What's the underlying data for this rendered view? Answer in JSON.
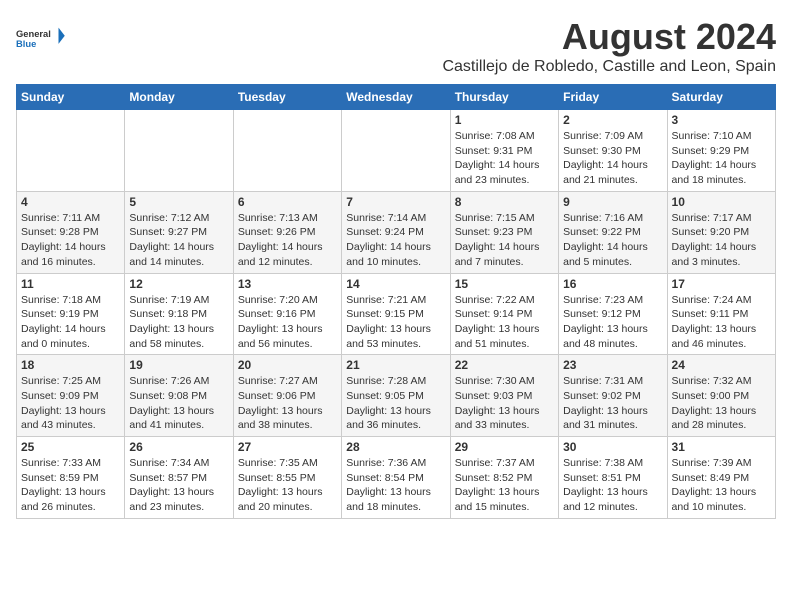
{
  "header": {
    "logo_general": "General",
    "logo_blue": "Blue",
    "month_year": "August 2024",
    "location": "Castillejo de Robledo, Castille and Leon, Spain"
  },
  "weekdays": [
    "Sunday",
    "Monday",
    "Tuesday",
    "Wednesday",
    "Thursday",
    "Friday",
    "Saturday"
  ],
  "weeks": [
    [
      {
        "day": "",
        "sunrise": "",
        "sunset": "",
        "daylight": ""
      },
      {
        "day": "",
        "sunrise": "",
        "sunset": "",
        "daylight": ""
      },
      {
        "day": "",
        "sunrise": "",
        "sunset": "",
        "daylight": ""
      },
      {
        "day": "",
        "sunrise": "",
        "sunset": "",
        "daylight": ""
      },
      {
        "day": "1",
        "sunrise": "Sunrise: 7:08 AM",
        "sunset": "Sunset: 9:31 PM",
        "daylight": "Daylight: 14 hours and 23 minutes."
      },
      {
        "day": "2",
        "sunrise": "Sunrise: 7:09 AM",
        "sunset": "Sunset: 9:30 PM",
        "daylight": "Daylight: 14 hours and 21 minutes."
      },
      {
        "day": "3",
        "sunrise": "Sunrise: 7:10 AM",
        "sunset": "Sunset: 9:29 PM",
        "daylight": "Daylight: 14 hours and 18 minutes."
      }
    ],
    [
      {
        "day": "4",
        "sunrise": "Sunrise: 7:11 AM",
        "sunset": "Sunset: 9:28 PM",
        "daylight": "Daylight: 14 hours and 16 minutes."
      },
      {
        "day": "5",
        "sunrise": "Sunrise: 7:12 AM",
        "sunset": "Sunset: 9:27 PM",
        "daylight": "Daylight: 14 hours and 14 minutes."
      },
      {
        "day": "6",
        "sunrise": "Sunrise: 7:13 AM",
        "sunset": "Sunset: 9:26 PM",
        "daylight": "Daylight: 14 hours and 12 minutes."
      },
      {
        "day": "7",
        "sunrise": "Sunrise: 7:14 AM",
        "sunset": "Sunset: 9:24 PM",
        "daylight": "Daylight: 14 hours and 10 minutes."
      },
      {
        "day": "8",
        "sunrise": "Sunrise: 7:15 AM",
        "sunset": "Sunset: 9:23 PM",
        "daylight": "Daylight: 14 hours and 7 minutes."
      },
      {
        "day": "9",
        "sunrise": "Sunrise: 7:16 AM",
        "sunset": "Sunset: 9:22 PM",
        "daylight": "Daylight: 14 hours and 5 minutes."
      },
      {
        "day": "10",
        "sunrise": "Sunrise: 7:17 AM",
        "sunset": "Sunset: 9:20 PM",
        "daylight": "Daylight: 14 hours and 3 minutes."
      }
    ],
    [
      {
        "day": "11",
        "sunrise": "Sunrise: 7:18 AM",
        "sunset": "Sunset: 9:19 PM",
        "daylight": "Daylight: 14 hours and 0 minutes."
      },
      {
        "day": "12",
        "sunrise": "Sunrise: 7:19 AM",
        "sunset": "Sunset: 9:18 PM",
        "daylight": "Daylight: 13 hours and 58 minutes."
      },
      {
        "day": "13",
        "sunrise": "Sunrise: 7:20 AM",
        "sunset": "Sunset: 9:16 PM",
        "daylight": "Daylight: 13 hours and 56 minutes."
      },
      {
        "day": "14",
        "sunrise": "Sunrise: 7:21 AM",
        "sunset": "Sunset: 9:15 PM",
        "daylight": "Daylight: 13 hours and 53 minutes."
      },
      {
        "day": "15",
        "sunrise": "Sunrise: 7:22 AM",
        "sunset": "Sunset: 9:14 PM",
        "daylight": "Daylight: 13 hours and 51 minutes."
      },
      {
        "day": "16",
        "sunrise": "Sunrise: 7:23 AM",
        "sunset": "Sunset: 9:12 PM",
        "daylight": "Daylight: 13 hours and 48 minutes."
      },
      {
        "day": "17",
        "sunrise": "Sunrise: 7:24 AM",
        "sunset": "Sunset: 9:11 PM",
        "daylight": "Daylight: 13 hours and 46 minutes."
      }
    ],
    [
      {
        "day": "18",
        "sunrise": "Sunrise: 7:25 AM",
        "sunset": "Sunset: 9:09 PM",
        "daylight": "Daylight: 13 hours and 43 minutes."
      },
      {
        "day": "19",
        "sunrise": "Sunrise: 7:26 AM",
        "sunset": "Sunset: 9:08 PM",
        "daylight": "Daylight: 13 hours and 41 minutes."
      },
      {
        "day": "20",
        "sunrise": "Sunrise: 7:27 AM",
        "sunset": "Sunset: 9:06 PM",
        "daylight": "Daylight: 13 hours and 38 minutes."
      },
      {
        "day": "21",
        "sunrise": "Sunrise: 7:28 AM",
        "sunset": "Sunset: 9:05 PM",
        "daylight": "Daylight: 13 hours and 36 minutes."
      },
      {
        "day": "22",
        "sunrise": "Sunrise: 7:30 AM",
        "sunset": "Sunset: 9:03 PM",
        "daylight": "Daylight: 13 hours and 33 minutes."
      },
      {
        "day": "23",
        "sunrise": "Sunrise: 7:31 AM",
        "sunset": "Sunset: 9:02 PM",
        "daylight": "Daylight: 13 hours and 31 minutes."
      },
      {
        "day": "24",
        "sunrise": "Sunrise: 7:32 AM",
        "sunset": "Sunset: 9:00 PM",
        "daylight": "Daylight: 13 hours and 28 minutes."
      }
    ],
    [
      {
        "day": "25",
        "sunrise": "Sunrise: 7:33 AM",
        "sunset": "Sunset: 8:59 PM",
        "daylight": "Daylight: 13 hours and 26 minutes."
      },
      {
        "day": "26",
        "sunrise": "Sunrise: 7:34 AM",
        "sunset": "Sunset: 8:57 PM",
        "daylight": "Daylight: 13 hours and 23 minutes."
      },
      {
        "day": "27",
        "sunrise": "Sunrise: 7:35 AM",
        "sunset": "Sunset: 8:55 PM",
        "daylight": "Daylight: 13 hours and 20 minutes."
      },
      {
        "day": "28",
        "sunrise": "Sunrise: 7:36 AM",
        "sunset": "Sunset: 8:54 PM",
        "daylight": "Daylight: 13 hours and 18 minutes."
      },
      {
        "day": "29",
        "sunrise": "Sunrise: 7:37 AM",
        "sunset": "Sunset: 8:52 PM",
        "daylight": "Daylight: 13 hours and 15 minutes."
      },
      {
        "day": "30",
        "sunrise": "Sunrise: 7:38 AM",
        "sunset": "Sunset: 8:51 PM",
        "daylight": "Daylight: 13 hours and 12 minutes."
      },
      {
        "day": "31",
        "sunrise": "Sunrise: 7:39 AM",
        "sunset": "Sunset: 8:49 PM",
        "daylight": "Daylight: 13 hours and 10 minutes."
      }
    ]
  ]
}
